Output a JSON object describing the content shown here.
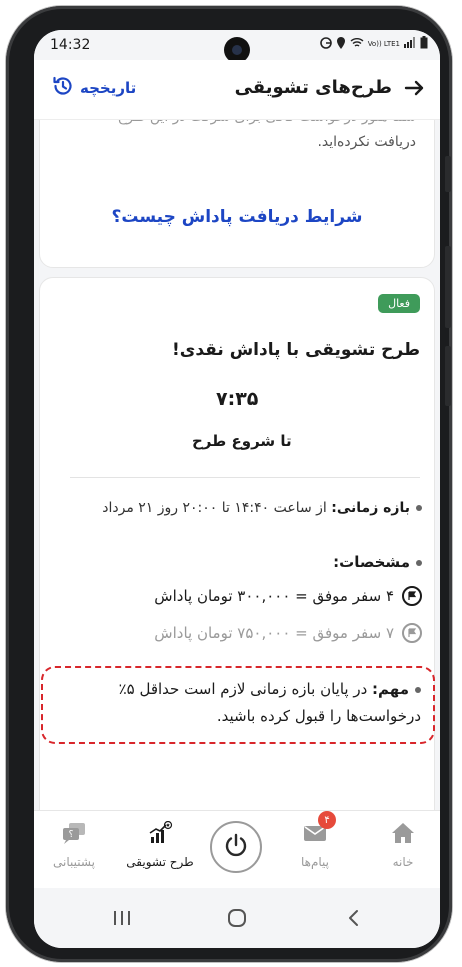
{
  "status_bar": {
    "time": "14:32",
    "network_label": "Vo)) LTE1"
  },
  "header": {
    "title": "طرح‌های تشویقی",
    "history_label": "تاریخچه"
  },
  "info_card": {
    "text_cut": "شما هنوز درخواست کافی برای شرکت در این طرح",
    "text": "دریافت نکرده‌اید.",
    "conditions_link": "شرایط دریافت پاداش چیست؟"
  },
  "campaign": {
    "badge": "فعال",
    "title": "طرح تشویقی با پاداش نقدی!",
    "countdown": "۷:۳۵",
    "countdown_label": "تا شروع طرح",
    "period_label": "بازه زمانی:",
    "period_value": "از ساعت ۱۴:۴۰ تا ۲۰:۰۰ روز ۲۱ مرداد",
    "specs_heading": "مشخصات:",
    "specs": [
      {
        "text": "۴ سفر موفق = ۳۰۰,۰۰۰ تومان پاداش",
        "active": true
      },
      {
        "text": "۷ سفر موفق = ۷۵۰,۰۰۰ تومان پاداش",
        "active": false
      }
    ],
    "important_label": "مهم:",
    "important_text": "در پایان بازه زمانی لازم است حداقل ۵٪ درخواست‌ها را قبول کرده باشید."
  },
  "bottom_nav": {
    "items": [
      {
        "label": "خانه",
        "icon": "home-icon"
      },
      {
        "label": "پیام‌ها",
        "icon": "mail-icon",
        "badge": "۴"
      },
      {
        "label": "",
        "icon": "power-icon"
      },
      {
        "label": "طرح تشویقی",
        "icon": "chart-icon"
      },
      {
        "label": "پشتیبانی",
        "icon": "support-icon"
      }
    ]
  },
  "colors": {
    "accent_blue": "#1d46c4",
    "active_green": "#3f9b5a",
    "alert_red": "#d8262b"
  }
}
